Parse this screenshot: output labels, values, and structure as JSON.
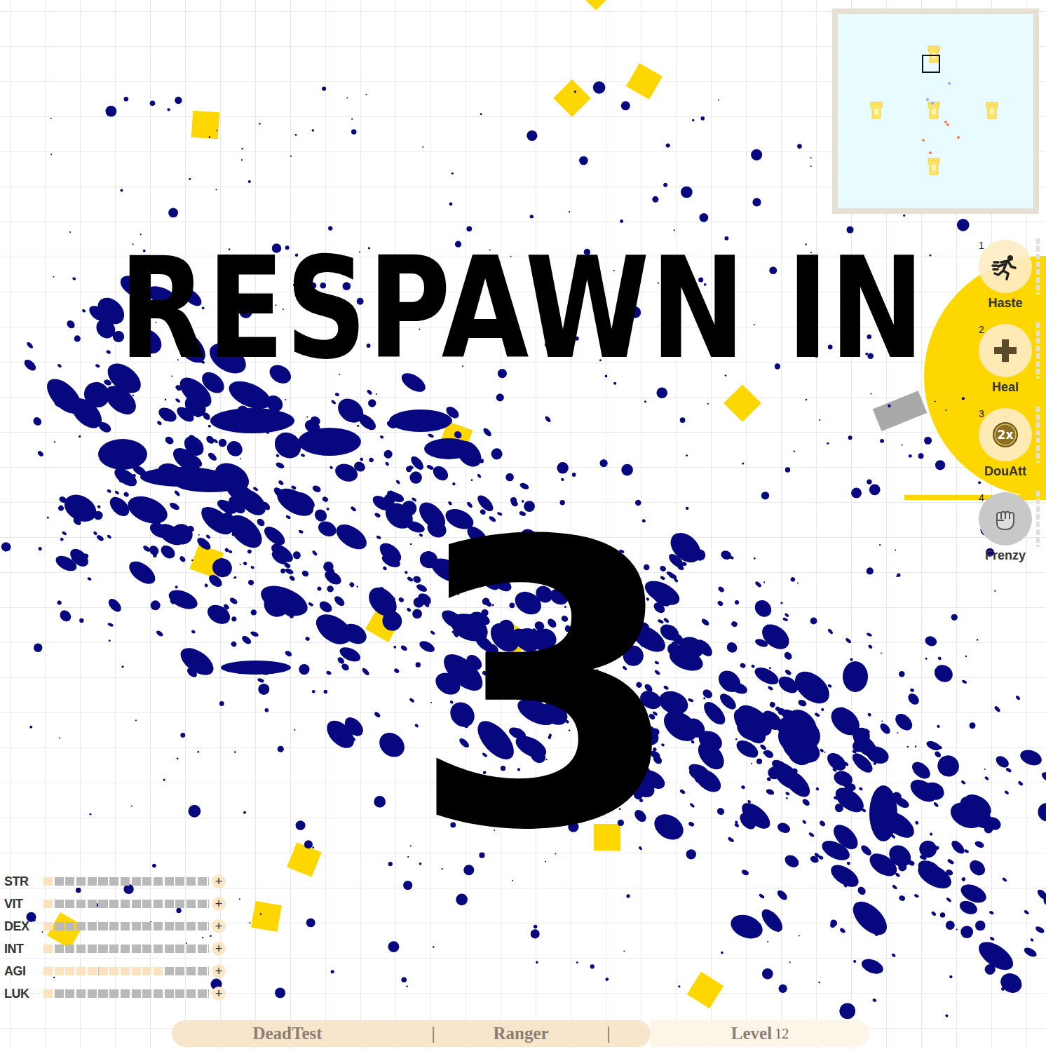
{
  "respawn": {
    "title": "RESPAWN IN",
    "countdown": "3"
  },
  "skills": [
    {
      "key": "1",
      "label": "Haste",
      "disabled": false
    },
    {
      "key": "2",
      "label": "Heal",
      "disabled": false
    },
    {
      "key": "3",
      "label": "DouAtt",
      "icon_text": "2x",
      "disabled": false
    },
    {
      "key": "4",
      "label": "Frenzy",
      "disabled": true
    }
  ],
  "stats": [
    {
      "label": "STR",
      "level": 0.067,
      "button": "+"
    },
    {
      "label": "VIT",
      "level": 0.067,
      "button": "+"
    },
    {
      "label": "DEX",
      "level": 0.067,
      "button": "+"
    },
    {
      "label": "INT",
      "level": 0.067,
      "button": "+"
    },
    {
      "label": "AGI",
      "level": 0.733,
      "button": "+"
    },
    {
      "label": "LUK",
      "level": 0.067,
      "button": "+"
    }
  ],
  "player_bar": {
    "name": "DeadTest",
    "separator1": "|",
    "class": "Ranger",
    "separator2": "|",
    "level_label": "Level",
    "level": "12"
  }
}
